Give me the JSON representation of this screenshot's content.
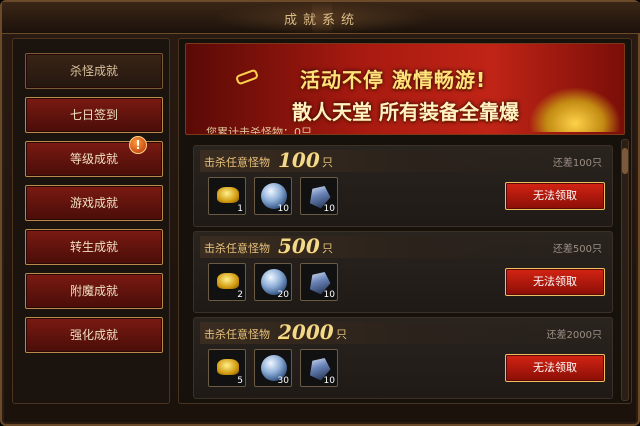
{
  "window": {
    "title": "成就系统",
    "close_icon": "close-icon"
  },
  "sidebar": {
    "items": [
      {
        "label": "杀怪成就",
        "active": true
      },
      {
        "label": "七日签到",
        "active": false
      },
      {
        "label": "等级成就",
        "active": false,
        "badge": "!"
      },
      {
        "label": "游戏成就",
        "active": false
      },
      {
        "label": "转生成就",
        "active": false
      },
      {
        "label": "附魔成就",
        "active": false
      },
      {
        "label": "强化成就",
        "active": false
      }
    ]
  },
  "banner": {
    "line1": "活动不停  激情畅游!",
    "line2": "散人天堂 所有装备全靠爆"
  },
  "kill_count": "您累计击杀怪物：0只",
  "achievements": [
    {
      "label": "击杀任意怪物",
      "target": "100",
      "unit": "只",
      "remaining": "还差100只",
      "button": "无法领取",
      "rewards": [
        {
          "icon": "gold-ingot-icon",
          "count": "1"
        },
        {
          "icon": "crystal-orb-icon",
          "count": "10"
        },
        {
          "icon": "gem-stone-icon",
          "count": "10"
        }
      ]
    },
    {
      "label": "击杀任意怪物",
      "target": "500",
      "unit": "只",
      "remaining": "还差500只",
      "button": "无法领取",
      "rewards": [
        {
          "icon": "gold-ingot-icon",
          "count": "2"
        },
        {
          "icon": "crystal-orb-icon",
          "count": "20"
        },
        {
          "icon": "gem-stone-icon",
          "count": "10"
        }
      ]
    },
    {
      "label": "击杀任意怪物",
      "target": "2000",
      "unit": "只",
      "remaining": "还差2000只",
      "button": "无法领取",
      "rewards": [
        {
          "icon": "gold-ingot-icon",
          "count": "5"
        },
        {
          "icon": "crystal-orb-icon",
          "count": "30"
        },
        {
          "icon": "gem-stone-icon",
          "count": "10"
        }
      ]
    }
  ],
  "colors": {
    "accent_red": "#a81a10",
    "gold_text": "#f3d98a",
    "border_gold": "#b88a4a"
  }
}
